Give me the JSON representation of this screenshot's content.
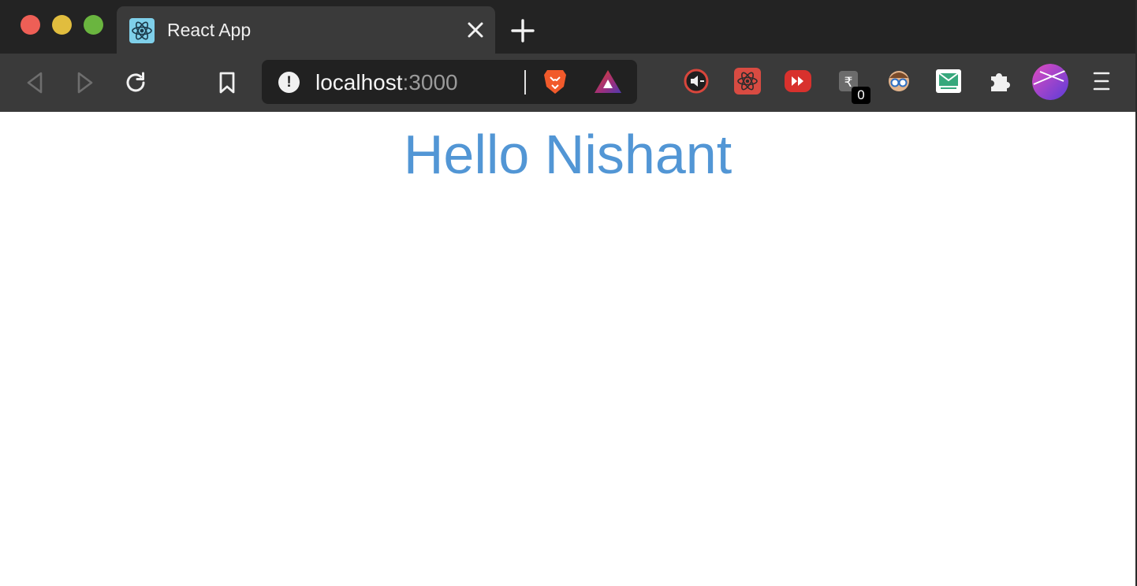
{
  "tabs": [
    {
      "title": "React App",
      "favicon": "react-logo-icon",
      "active": true
    }
  ],
  "address_bar": {
    "host": "localhost",
    "port": ":3000",
    "site_info_icon": "info-warning-icon"
  },
  "extensions": {
    "icons": [
      "volume-extension-icon",
      "react-devtools-extension-icon",
      "video-speed-extension-icon",
      "rupee-extension-icon",
      "nerd-glasses-extension-icon",
      "temp-mail-extension-icon",
      "puzzle-extensions-icon",
      "profile-avatar-icon",
      "menu-icon"
    ],
    "badge_count": "0"
  },
  "page": {
    "greeting": "Hello Nishant"
  },
  "colors": {
    "greeting": "#5296d5",
    "tabstrip": "#232323",
    "toolbar": "#3a3a3a",
    "omnibox": "#212121"
  }
}
